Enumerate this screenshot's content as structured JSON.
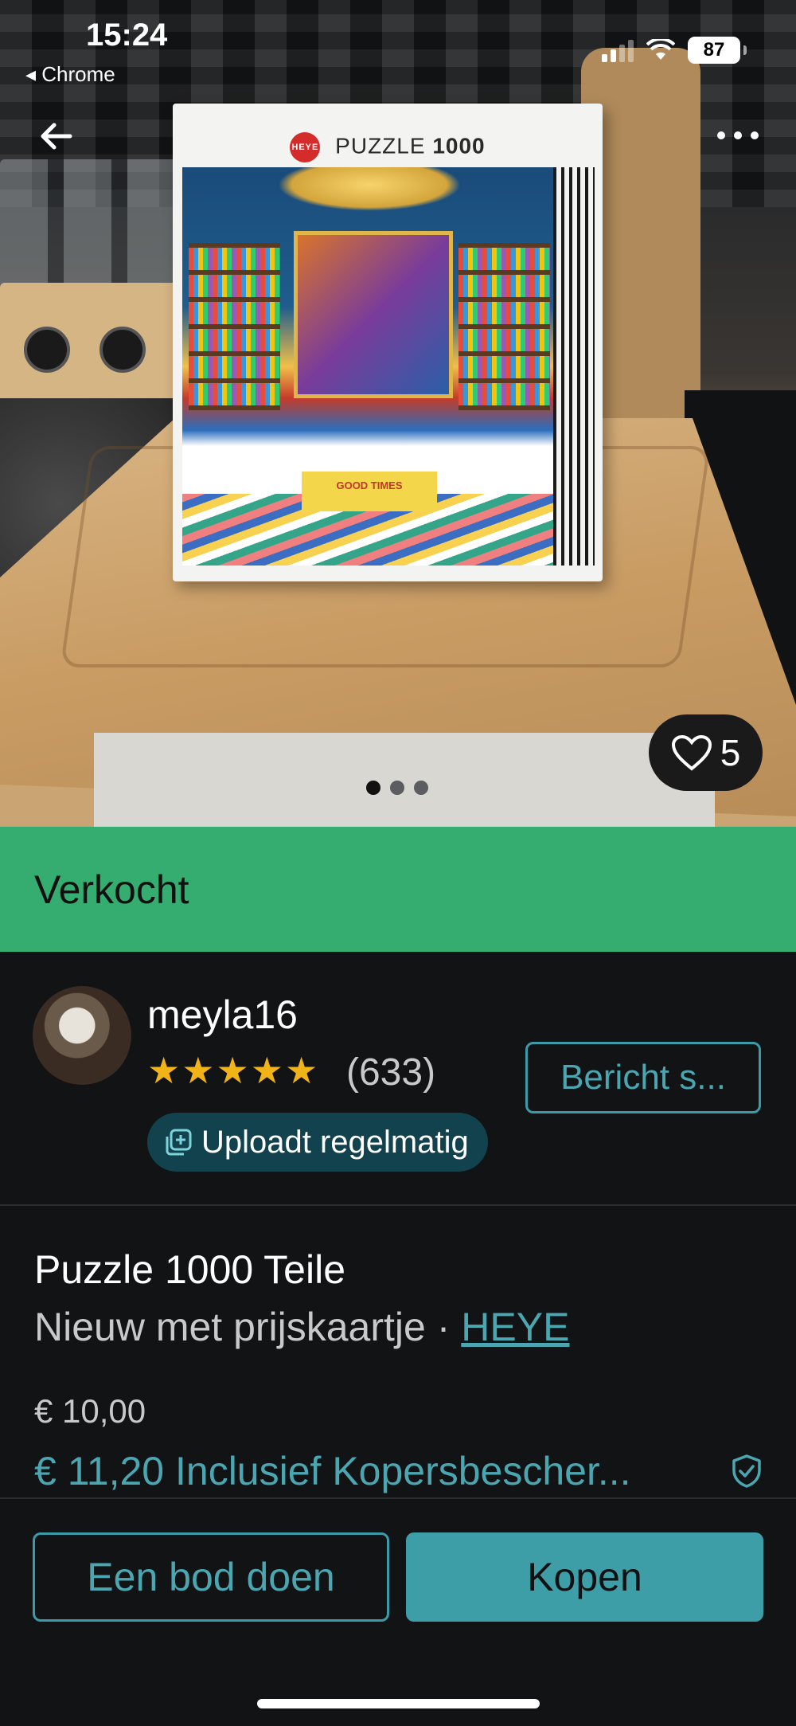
{
  "status_bar": {
    "time": "15:24",
    "back_app": "◂ Chrome",
    "battery": "87"
  },
  "photo": {
    "box_brand": "HEYE",
    "box_label": "PUZZLE",
    "box_count": "1000",
    "box_sign": "GOOD TIMES",
    "likes": "5",
    "carousel_total": 3,
    "carousel_active": 1
  },
  "sold_banner": {
    "label": "Verkocht",
    "color": "#35ad70"
  },
  "seller": {
    "username": "meyla16",
    "stars": "★★★★★",
    "reviews": "(633)",
    "message_button": "Bericht s...",
    "badge": "Uploadt regelmatig"
  },
  "item": {
    "title": "Puzzle 1000 Teile",
    "condition": "Nieuw met prijskaartje",
    "separator": " · ",
    "brand": "HEYE",
    "price": "€ 10,00",
    "price_incl": "€ 11,20 Inclusief Kopersbescher..."
  },
  "actions": {
    "offer": "Een bod doen",
    "buy": "Kopen"
  },
  "colors": {
    "accent": "#4aa7b2",
    "background": "#121315",
    "star": "#f0b419"
  }
}
